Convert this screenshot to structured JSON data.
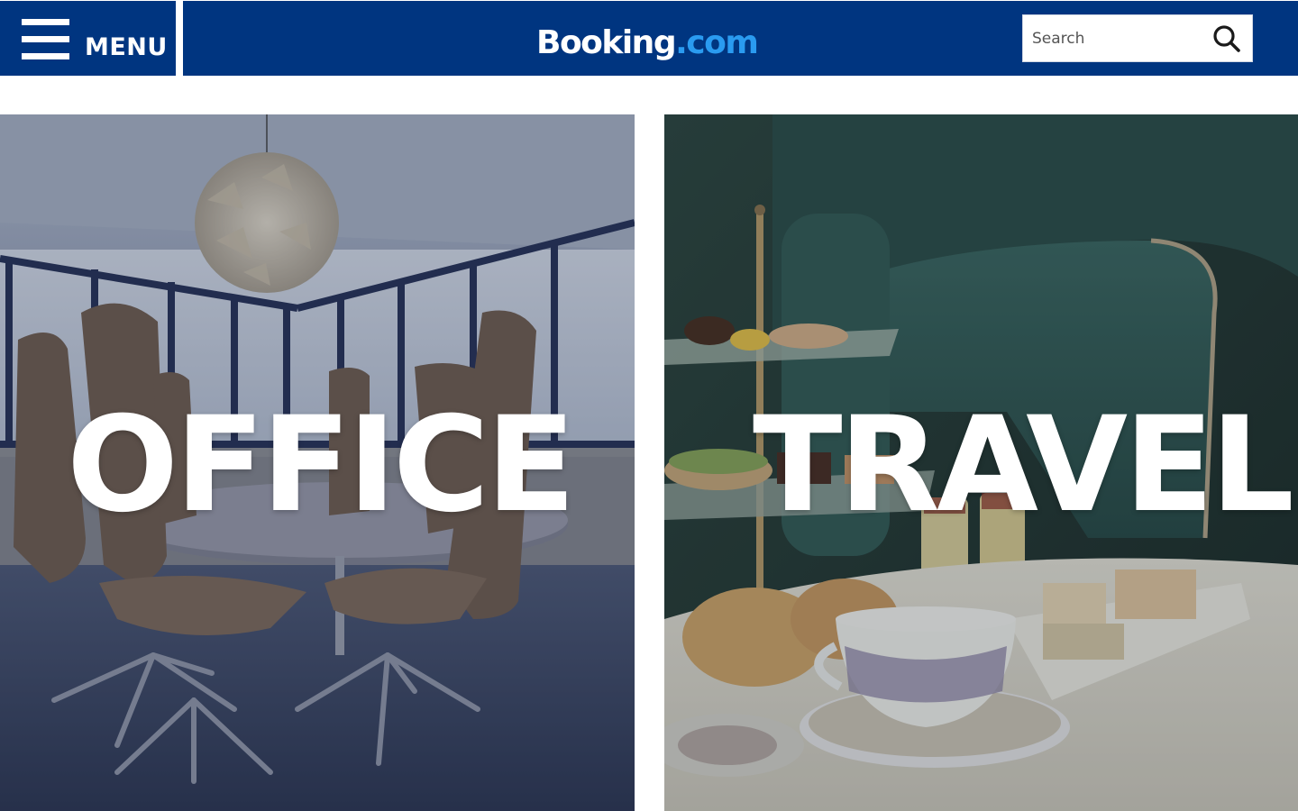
{
  "header": {
    "menu_label": "MENU",
    "logo_booking": "Booking",
    "logo_dotcom": ".com",
    "search_placeholder": "Search"
  },
  "panels": [
    {
      "title": "OFFICE"
    },
    {
      "title": "TRAVEL"
    }
  ],
  "colors": {
    "brand_blue": "#003580",
    "logo_accent": "#2a9bf0"
  },
  "icons": {
    "menu": "hamburger-icon",
    "search": "search-icon"
  }
}
